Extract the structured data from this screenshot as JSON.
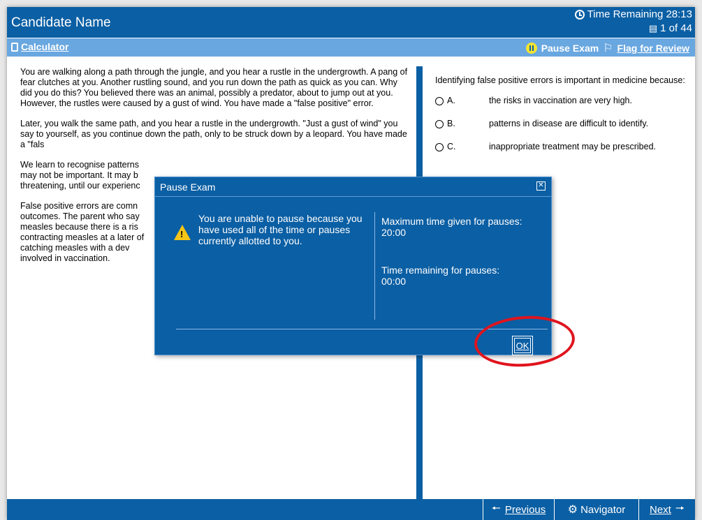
{
  "header": {
    "candidate_name": "Candidate Name",
    "time_remaining_label": "Time Remaining 28:13",
    "page_counter": "1 of 44",
    "clock_icon": "clock-icon",
    "pages_icon": "pages-icon"
  },
  "toolbar": {
    "calculator_label": "Calculator",
    "pause_label": "Pause Exam",
    "flag_label": "Flag for Review"
  },
  "passage": {
    "paragraphs": [
      "You are walking along a path through the jungle, and you hear a rustle in the undergrowth. A pang of fear clutches at you. Another rustling sound, and you run down the path as quick as you can. Why did you do this? You believed there was an animal, possibly a predator, about to jump out at you. However, the rustles were caused by a gust of wind. You have made a \"false positive\" error.",
      "Later, you walk the same path, and you hear a rustle in the undergrowth. \"Just a gust of wind\" you say to yourself, as you continue down the path, only to be struck down by a leopard. You have made a \"fals",
      "We learn to recognise patterns may not be important. It may b threatening, until our experienc",
      "False positive errors are comn outcomes. The parent who say measles because there is a ris contracting measles at a later of catching measles with a dev involved in vaccination."
    ]
  },
  "question": {
    "stem": "Identifying false positive errors is important in medicine because:",
    "options": [
      {
        "letter": "A.",
        "text": "the risks in vaccination are very high."
      },
      {
        "letter": "B.",
        "text": "patterns in disease are difficult to identify."
      },
      {
        "letter": "C.",
        "text": "inappropriate treatment may be prescribed."
      }
    ]
  },
  "dialog": {
    "title": "Pause Exam",
    "message": "You are unable to pause because you have used all of the time or pauses currently allotted to you.",
    "max_time_label": "Maximum time given for pauses:",
    "max_time_value": "20:00",
    "remaining_label": "Time remaining for pauses:",
    "remaining_value": "00:00",
    "ok_label": "OK"
  },
  "footer": {
    "previous_label": "Previous",
    "navigator_label": "Navigator",
    "next_label": "Next"
  },
  "colors": {
    "primary": "#0b5fa4",
    "toolbar": "#69a7e0",
    "annotation": "#e0141e"
  }
}
